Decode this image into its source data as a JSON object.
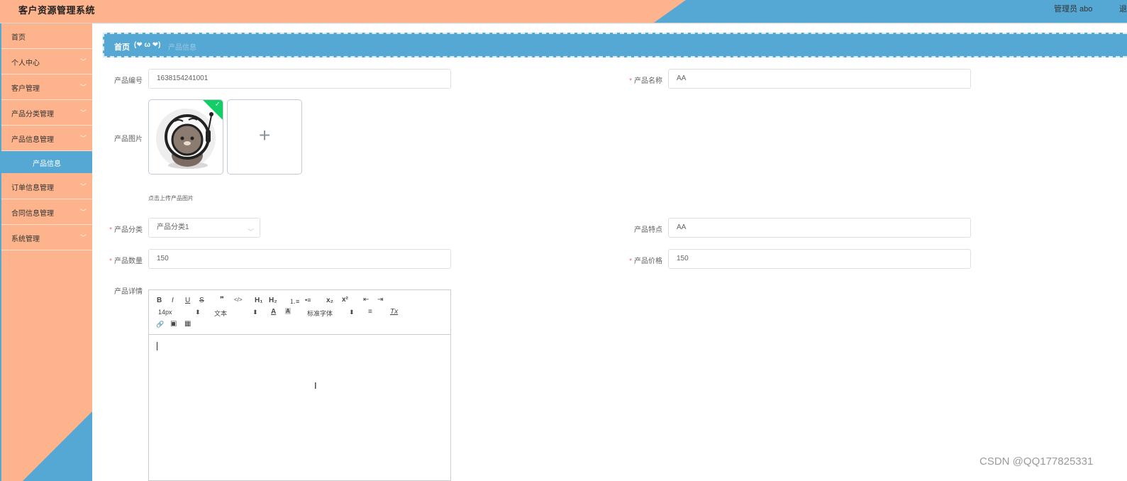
{
  "header": {
    "title": "客户资源管理系统",
    "user": "管理员 abo",
    "logout": "退"
  },
  "sidebar": {
    "items": [
      {
        "label": "首页",
        "arrow": ""
      },
      {
        "label": "个人中心",
        "arrow": "﹀"
      },
      {
        "label": "客户管理",
        "arrow": "﹀"
      },
      {
        "label": "产品分类管理",
        "arrow": "﹀"
      },
      {
        "label": "产品信息管理",
        "arrow": "﹀"
      },
      {
        "label": "订单信息管理",
        "arrow": "﹀"
      },
      {
        "label": "合同信息管理",
        "arrow": "﹀"
      },
      {
        "label": "系统管理",
        "arrow": "﹀"
      }
    ],
    "active_sub": "产品信息"
  },
  "breadcrumb": {
    "home": "首页",
    "separator": "(❤ ω ❤)",
    "current": "产品信息"
  },
  "form": {
    "code": {
      "label": "产品编号",
      "value": "1638154241001"
    },
    "name": {
      "label": "产品名称",
      "value": "AA",
      "required": "*"
    },
    "image": {
      "label": "产品图片",
      "tip": "点击上传产品图片",
      "add": "+",
      "check": "✓"
    },
    "category": {
      "label": "产品分类",
      "value": "产品分类1",
      "required": "*"
    },
    "feature": {
      "label": "产品特点",
      "value": "AA"
    },
    "quantity": {
      "label": "产品数量",
      "value": "150",
      "required": "*"
    },
    "price": {
      "label": "产品价格",
      "value": "150",
      "required": "*"
    },
    "detail": {
      "label": "产品详情"
    }
  },
  "editor": {
    "bold": "B",
    "italic": "I",
    "underline": "U",
    "strike": "S",
    "quote": "❞",
    "code": "</>",
    "h1": "H₁",
    "h2": "H₂",
    "ordered": "⒈≡",
    "bullet": "•≡",
    "sub": "x₂",
    "sup": "x²",
    "outdent": "⇤",
    "indent": "⇥",
    "size": "14px",
    "block": "文本",
    "font": "标准字体",
    "color": "A",
    "bg": "A",
    "align": "≡",
    "clear": "Tx",
    "link": "🔗",
    "image": "▣",
    "video": "▦",
    "updown": "⬍"
  },
  "watermark": "CSDN @QQ177825331",
  "colors": {
    "peach": "#fdb38b",
    "blue": "#55a8d4",
    "required": "#f56c6c",
    "success": "#13ce66"
  }
}
